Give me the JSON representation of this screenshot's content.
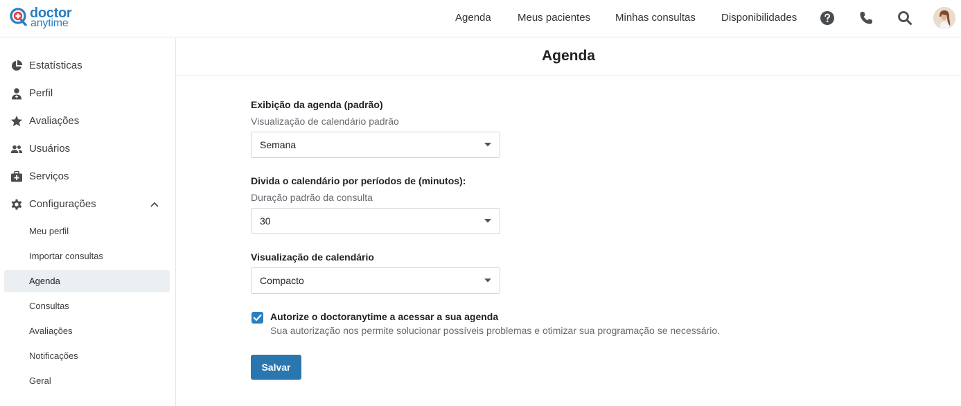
{
  "brand": {
    "line1": "doctor",
    "line2": "anytime",
    "color": "#2a7ebf",
    "accent": "#e0393e"
  },
  "nav": {
    "items": [
      "Agenda",
      "Meus pacientes",
      "Minhas consultas",
      "Disponibilidades"
    ],
    "icons": [
      "help-icon",
      "phone-icon",
      "search-icon"
    ]
  },
  "sidebar": {
    "items": [
      {
        "label": "Estatísticas",
        "icon": "pie-chart-icon"
      },
      {
        "label": "Perfil",
        "icon": "doctor-icon"
      },
      {
        "label": "Avaliações",
        "icon": "star-icon"
      },
      {
        "label": "Usuários",
        "icon": "users-icon"
      },
      {
        "label": "Serviços",
        "icon": "medical-kit-icon"
      },
      {
        "label": "Configurações",
        "icon": "gear-icon"
      }
    ],
    "subitems": [
      "Meu perfil",
      "Importar consultas",
      "Agenda",
      "Consultas",
      "Avaliações",
      "Notificações",
      "Geral"
    ],
    "active_subitem": "Agenda"
  },
  "main": {
    "title": "Agenda",
    "field1": {
      "title": "Exibição da agenda (padrão)",
      "subtitle": "Visualização de calendário padrão",
      "value": "Semana"
    },
    "field2": {
      "title": "Divida o calendário por períodos de (minutos):",
      "subtitle": "Duração padrão da consulta",
      "value": "30"
    },
    "field3": {
      "title": "Visualização de calendário",
      "value": "Compacto"
    },
    "authorize": {
      "checked": true,
      "label": "Autorize o doctoranytime a acessar a sua agenda",
      "help": "Sua autorização nos permite solucionar possíveis problemas e otimizar sua programação se necessário."
    },
    "save_label": "Salvar"
  },
  "colors": {
    "primary": "#2a76ae",
    "checkbox": "#2680c2",
    "active_bg": "#eceff1"
  }
}
